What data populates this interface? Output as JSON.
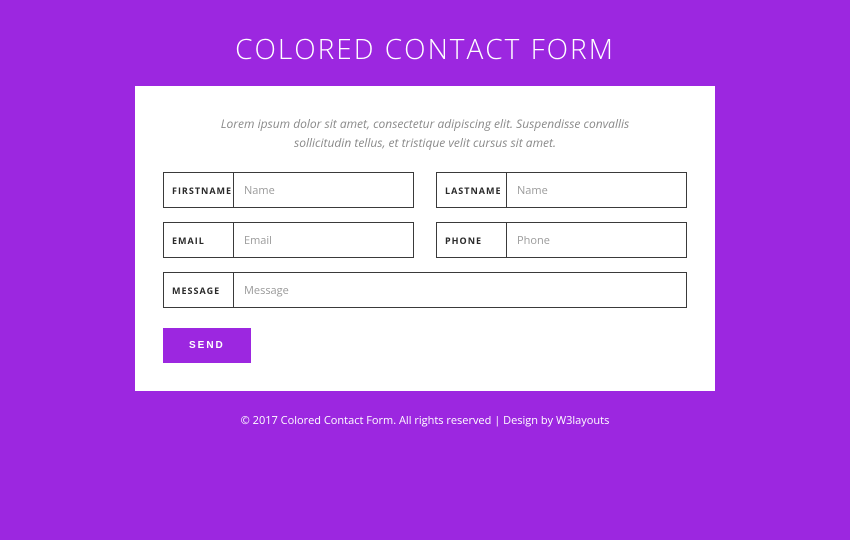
{
  "title": "COLORED CONTACT FORM",
  "intro_line1": "Lorem ipsum dolor sit amet, consectetur adipiscing elit. Suspendisse convallis",
  "intro_line2": "sollicitudin tellus, et tristique velit cursus sit amet.",
  "form": {
    "firstname": {
      "label": "FIRSTNAME",
      "placeholder": "Name",
      "value": ""
    },
    "lastname": {
      "label": "LASTNAME",
      "placeholder": "Name",
      "value": ""
    },
    "email": {
      "label": "EMAIL",
      "placeholder": "Email",
      "value": ""
    },
    "phone": {
      "label": "PHONE",
      "placeholder": "Phone",
      "value": ""
    },
    "message": {
      "label": "MESSAGE",
      "placeholder": "Message",
      "value": ""
    },
    "submit_label": "SEND"
  },
  "footer": {
    "copyright": "© 2017 Colored Contact Form. All rights reserved | Design by ",
    "link_text": "W3layouts"
  },
  "colors": {
    "brand": "#9c27e0",
    "card_bg": "#ffffff"
  }
}
